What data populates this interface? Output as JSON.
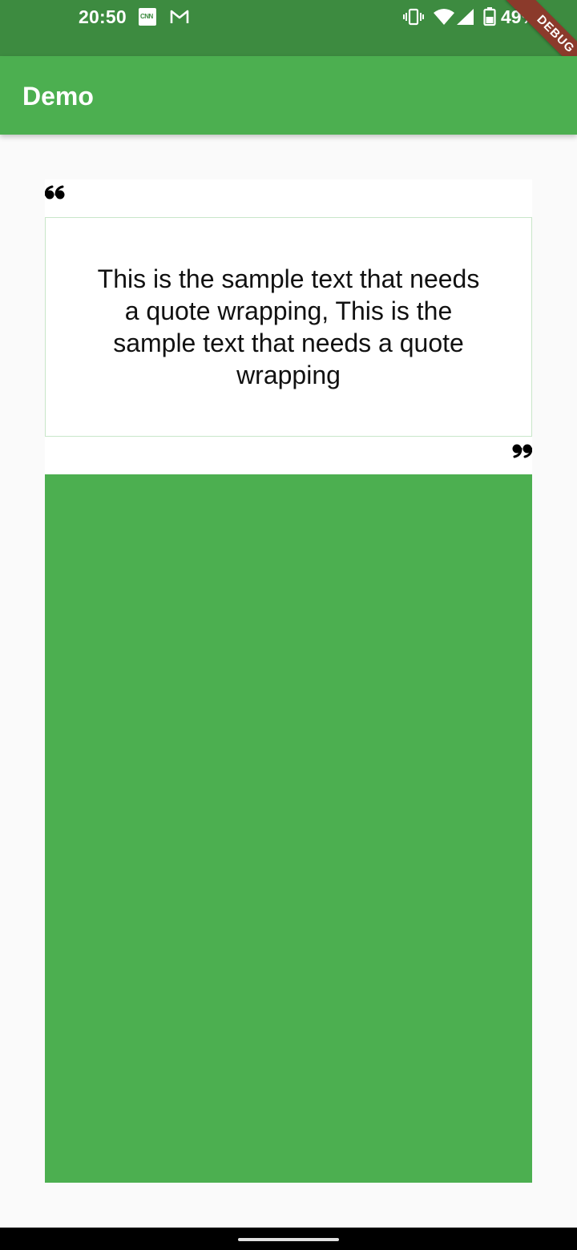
{
  "status_bar": {
    "time": "20:50",
    "battery": "49%",
    "notification_icons": [
      "cnn-icon",
      "gmail-icon"
    ],
    "system_icons": [
      "vibrate-icon",
      "wifi-icon",
      "signal-icon",
      "battery-icon"
    ],
    "color": "#3d8b40"
  },
  "debug_banner": {
    "label": "DEBUG",
    "color": "#8b3a2b"
  },
  "app_bar": {
    "title": "Demo",
    "color": "#4caf50"
  },
  "quote": {
    "open_icon": "open-quote-icon",
    "close_icon": "close-quote-icon",
    "text": "This is the sample text that needs a quote wrapping, This is the sample text that needs a quote wrapping",
    "border_color": "#c8e6c9"
  },
  "panel": {
    "color": "#4caf50"
  }
}
